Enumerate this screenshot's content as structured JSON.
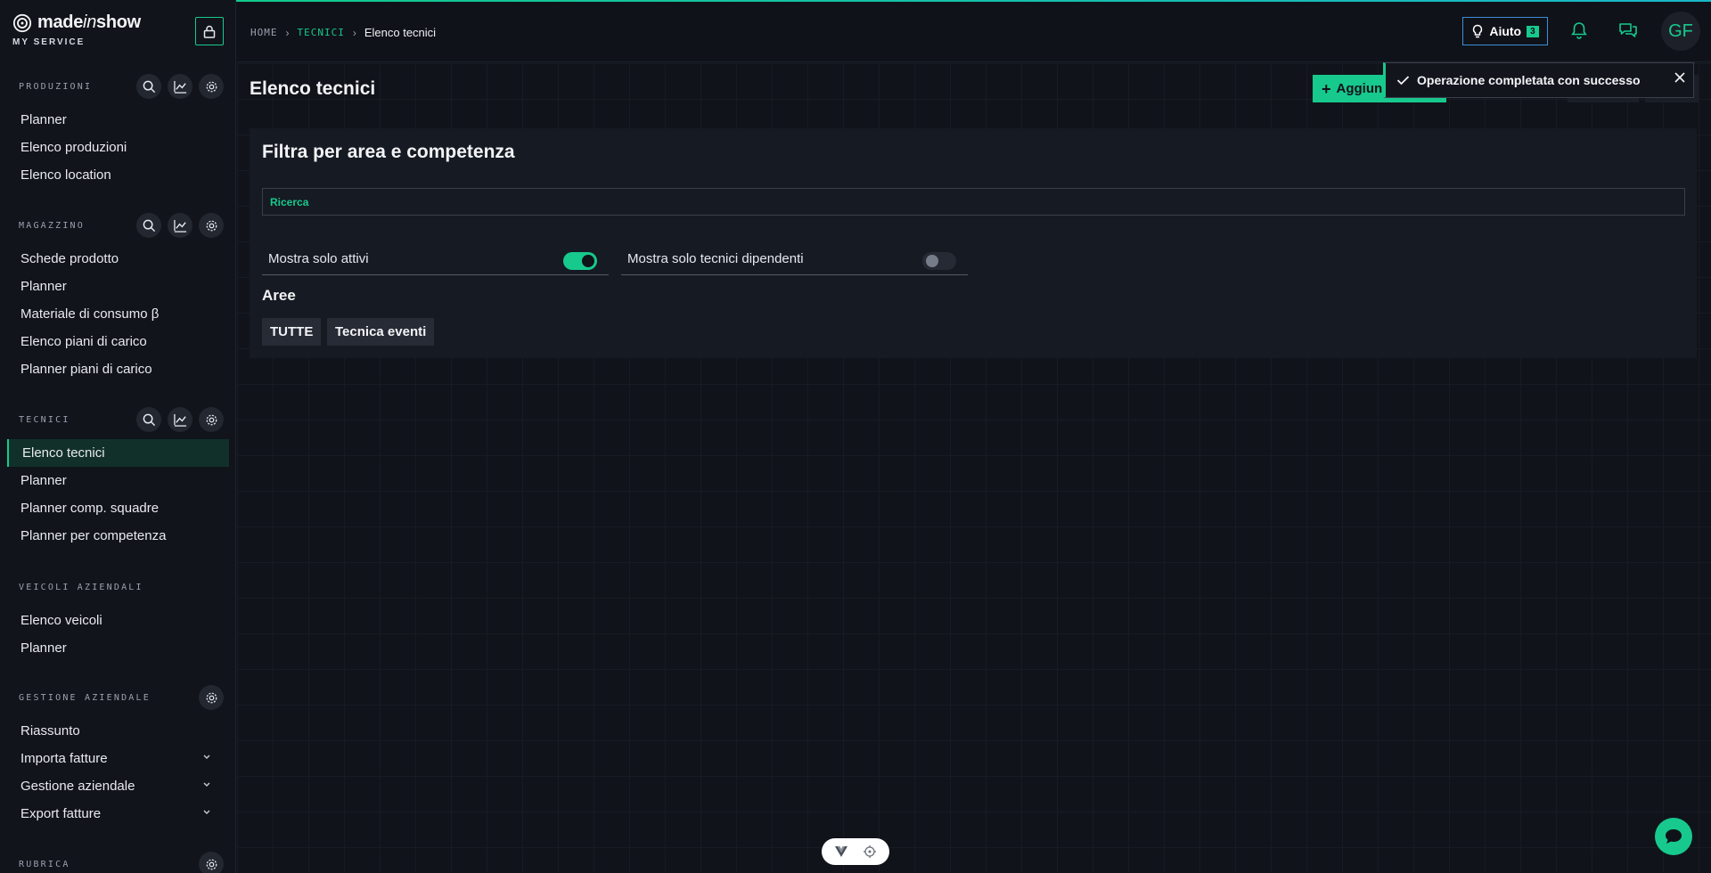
{
  "brand": {
    "name_bold": "made",
    "name_italic": "in",
    "name_end": "show",
    "subtitle": "MY SERVICE"
  },
  "sidebar": {
    "sections": [
      {
        "title": "PRODUZIONI",
        "items": [
          "Planner",
          "Elenco produzioni",
          "Elenco location"
        ]
      },
      {
        "title": "MAGAZZINO",
        "items": [
          "Schede prodotto",
          "Planner",
          "Materiale di consumo β",
          "Elenco piani di carico",
          "Planner piani di carico"
        ]
      },
      {
        "title": "TECNICI",
        "items": [
          "Elenco tecnici",
          "Planner",
          "Planner comp. squadre",
          "Planner per competenza"
        ]
      },
      {
        "title": "VEICOLI AZIENDALI",
        "items": [
          "Elenco veicoli",
          "Planner"
        ]
      },
      {
        "title": "GESTIONE AZIENDALE",
        "items": [
          "Riassunto",
          "Importa fatture",
          "Gestione aziendale",
          "Export fatture"
        ]
      },
      {
        "title": "RUBRICA",
        "items": []
      }
    ]
  },
  "header": {
    "breadcrumb": {
      "home": "HOME",
      "section": "TECNICI",
      "current": "Elenco tecnici"
    },
    "help_label": "Aiuto",
    "help_count": "3",
    "avatar_initials": "GF"
  },
  "main": {
    "page_title": "Elenco tecnici",
    "add_button_label": "Aggiun",
    "filter_panel": {
      "title": "Filtra per area e competenza",
      "search_label": "Ricerca",
      "toggle_active_label": "Mostra solo attivi",
      "toggle_active_on": true,
      "toggle_employees_label": "Mostra solo tecnici dipendenti",
      "toggle_employees_on": false,
      "areas_title": "Aree",
      "areas": [
        "TUTTE",
        "Tecnica eventi"
      ]
    }
  },
  "toast": {
    "message": "Operazione completata con successo"
  },
  "colors": {
    "accent": "#17c98c",
    "background": "#0f1219",
    "panel": "#161a22",
    "help_border": "#3e8fd6"
  }
}
